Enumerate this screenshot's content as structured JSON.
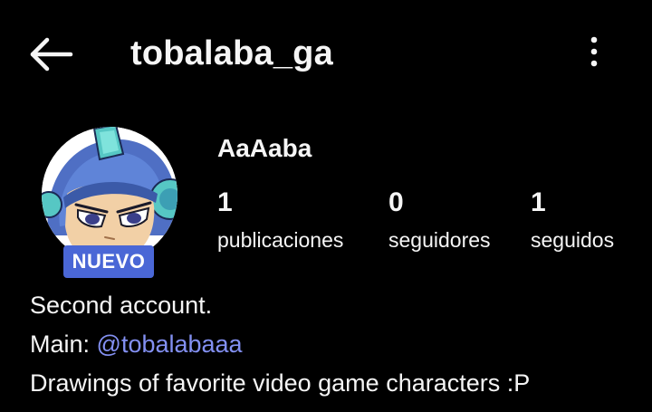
{
  "header": {
    "username": "tobalaba_ga",
    "back_icon": "arrow-left-icon",
    "more_icon": "more-vertical-icon"
  },
  "profile": {
    "display_name": "AaAaba",
    "badge": "NUEVO",
    "stats": [
      {
        "count": "1",
        "label": "publicaciones"
      },
      {
        "count": "0",
        "label": "seguidores"
      },
      {
        "count": "1",
        "label": "seguidos"
      }
    ]
  },
  "bio": {
    "line1": "Second account.",
    "line2_prefix": "Main: ",
    "line2_mention": "@tobalabaaa",
    "line3": "Drawings of favorite video game characters :P"
  },
  "colors": {
    "background": "#000000",
    "text": "#f5f5f5",
    "badge": "#4a67d6",
    "mention": "#8390f2"
  }
}
